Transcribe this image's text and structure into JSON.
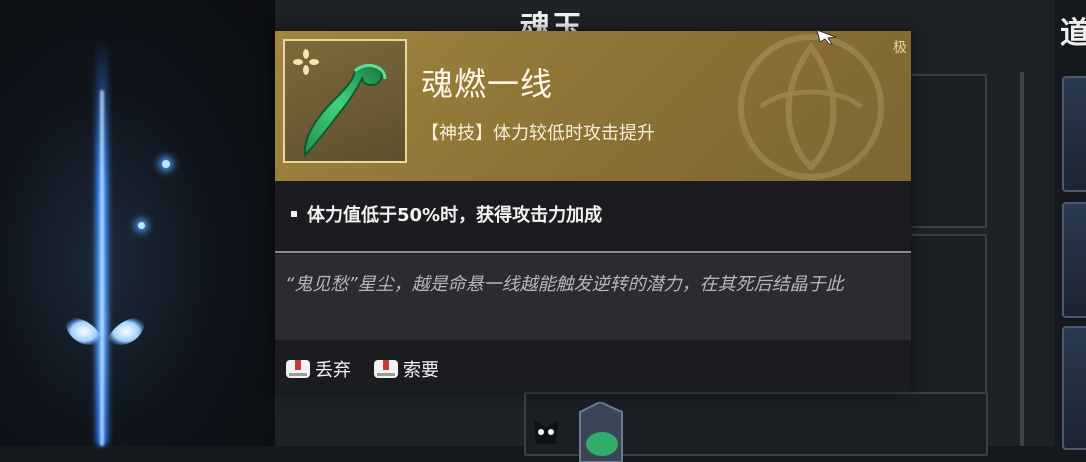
{
  "background": {
    "panel_title": "魂玉",
    "right_title": "道"
  },
  "tooltip": {
    "grade": "极",
    "item_name": "魂燃一线",
    "item_tag": "【神技】体力较低时攻击提升",
    "effect": "体力值低于50%时，获得攻击力加成",
    "lore": "“鬼见愁”星尘，越是命悬一线越能触发逆转的潜力，在其死后结晶于此",
    "actions": [
      {
        "label": "丢弃",
        "icon": "controller-button-icon"
      },
      {
        "label": "索要",
        "icon": "controller-button-icon"
      }
    ]
  },
  "colors": {
    "header_gold": "#a2863d",
    "beam_blue": "#3b8cff",
    "jade_green": "#2fbf6a"
  }
}
